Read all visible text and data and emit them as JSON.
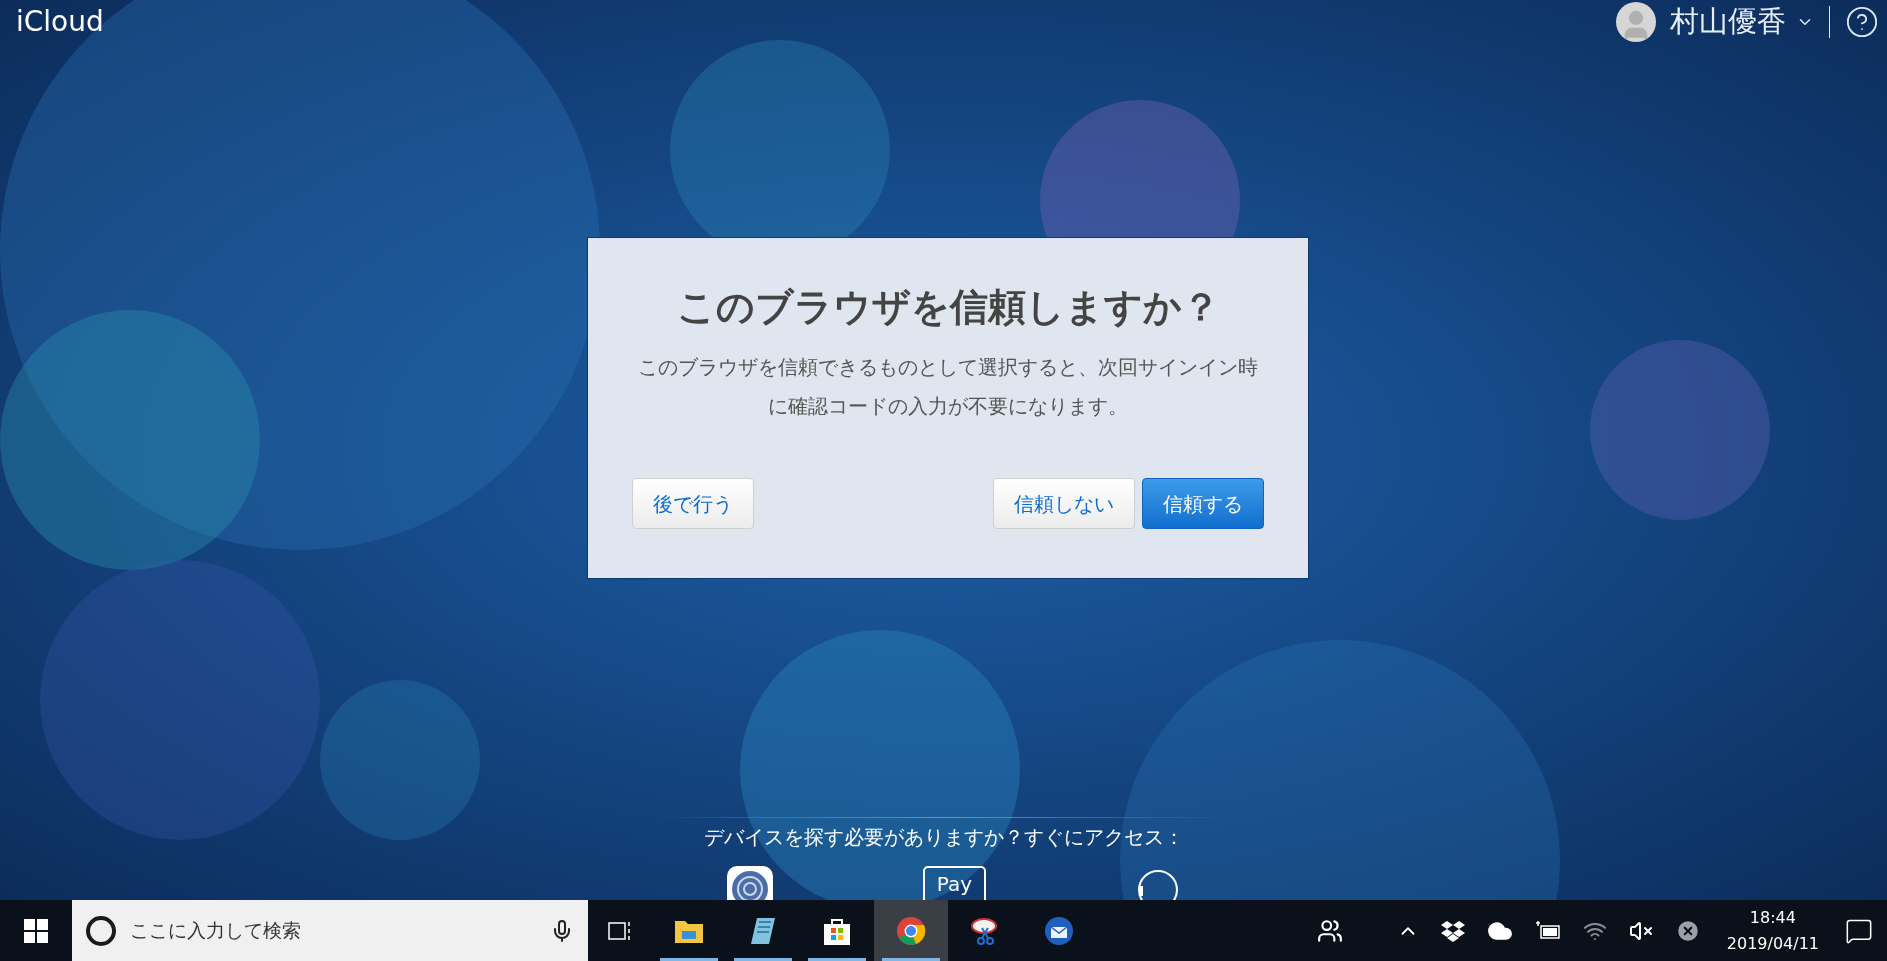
{
  "header": {
    "logo": "iCloud",
    "user_name": "村山優香"
  },
  "dialog": {
    "title": "このブラウザを信頼しますか？",
    "body": "このブラウザを信頼できるものとして選択すると、次回サインイン時に確認コードの入力が不要になります。",
    "buttons": [
      {
        "label": "後で行う",
        "kind": "secondary"
      },
      {
        "label": "信頼しない",
        "kind": "secondary"
      },
      {
        "label": "信頼する",
        "kind": "primary"
      }
    ]
  },
  "find_device": {
    "prompt": "デバイスを探す必要がありますか？すぐにアクセス：",
    "pay_label": "Pay"
  },
  "taskbar": {
    "search_placeholder": "ここに入力して検索",
    "apps": [
      {
        "kind": "folder",
        "running": true,
        "selected": false
      },
      {
        "kind": "notepad",
        "running": true,
        "selected": false
      },
      {
        "kind": "store",
        "running": true,
        "selected": false
      },
      {
        "kind": "chrome",
        "running": true,
        "selected": true
      },
      {
        "kind": "scissors",
        "running": false,
        "selected": false
      },
      {
        "kind": "mail",
        "running": false,
        "selected": false
      }
    ],
    "clock": {
      "time": "18:44",
      "date": "2019/04/11"
    }
  }
}
